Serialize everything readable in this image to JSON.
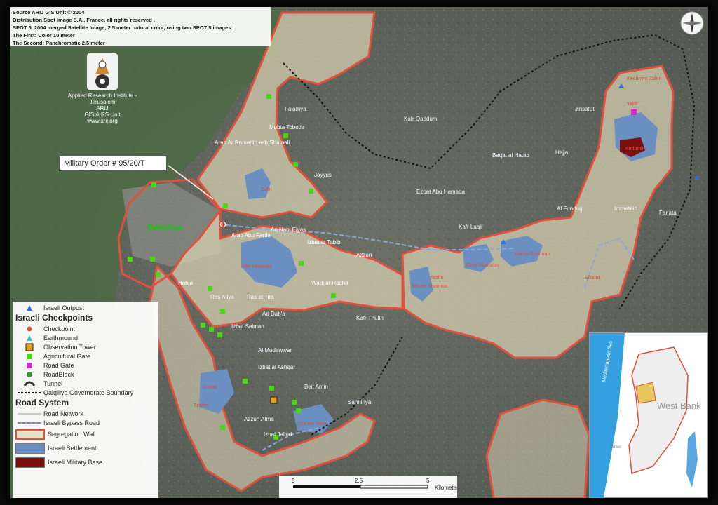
{
  "credit": {
    "lines": [
      "Source ARIJ GIS Unit © 2004",
      "Distribution Spot Image S.A., France, all rights reserved .",
      "SPOT 5, 2004 merged Satellite Image, 2.5 meter natural color, using two SPOT 5 images :",
      "The First: Color 10 meter",
      "The Second: Panchromatic 2.5 meter"
    ]
  },
  "institute": {
    "lines": [
      "Applied Research Institute - Jerusalem",
      "ARIJ",
      "GIS & RS Unit",
      "www.arij.org"
    ]
  },
  "callout": {
    "label": "Military Order # 95/20/T"
  },
  "map": {
    "city_label": "Qalqiliya",
    "places": [
      "Falamya",
      "Mubta Tobotie",
      "Arab Ar Ramadin ash Shamali",
      "Jayyus",
      "Azzun",
      "Kafr Qaddum",
      "Hajja",
      "Baqat al Hatab",
      "Jinsafut",
      "Ezbat Abu Hamada",
      "Kafr Laqif",
      "Immatain",
      "Far'ata",
      "Al Funduq",
      "An Nabi Elyas",
      "Arab Abu Farda",
      "Izbat at Tabib",
      "Wadi ar Rasha",
      "Ras at Tira",
      "Habla",
      "Ras Atiya",
      "Ad Dab'a",
      "Izbat Salman",
      "Kafr Thulth",
      "Al Mudawwar",
      "Izbat al Ashqar",
      "Beit Amin",
      "Sanniriya",
      "Azzun Atma",
      "Izbat Jal'ud"
    ],
    "settlements": [
      "Zufin",
      "Alfei Menashe",
      "Karnei Shomron",
      "Ginot Shomron",
      "Ma'ale Shomron",
      "Kedumim",
      "Kedumim Zafon",
      "Oranit",
      "Sha'are Tikva",
      "Elkana",
      "Tzofim",
      "Yakir",
      "Nofim"
    ]
  },
  "legend": {
    "outpost": "Israeli Outpost",
    "checkpoints_title": "Israeli Checkpoints",
    "checkpoint_items": [
      "Checkpoint",
      "Earthmound",
      "Observation Tower",
      "Agricultural Gate",
      "Road Gate",
      "RoadBlock",
      "Tunnel"
    ],
    "boundary": "Qalqiliya Governorate Boundary",
    "road_title": "Road System",
    "road_items": [
      "Road Network",
      "Israeli Bypass Road"
    ],
    "area_items": [
      "Segregation Wall",
      "Israeli Settlement",
      "Israeli Military Base"
    ]
  },
  "scale": {
    "ticks": [
      "0",
      "2.5",
      "5"
    ],
    "unit": "Kilometers"
  },
  "inset": {
    "sea": "Mediterranean Sea",
    "region": "West Bank",
    "country": "Israel"
  },
  "colors": {
    "wall": "#e0503c",
    "enclosed": "#d9d2b4",
    "settlement": "#6b8fc0",
    "military": "#7a1010",
    "gate": "#4cd41c",
    "road_gate": "#d424c4",
    "boundary": "#111111",
    "bypass": "#8aa7d8"
  }
}
